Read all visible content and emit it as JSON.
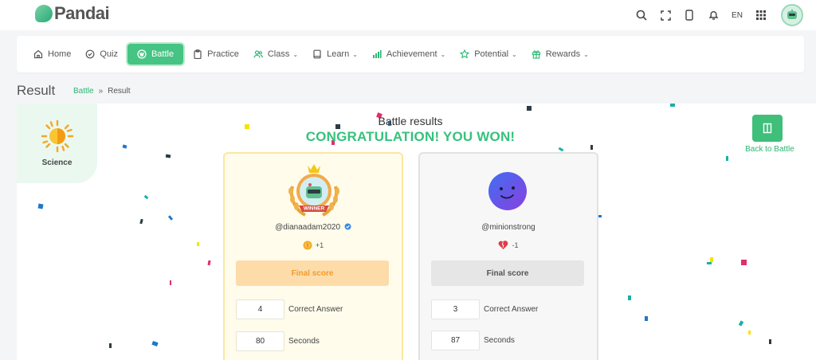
{
  "header": {
    "logo_text": "Pandai",
    "language": "EN",
    "icons": [
      "search-icon",
      "fullscreen-icon",
      "phone-icon",
      "bell-icon",
      "apps-grid-icon"
    ]
  },
  "nav": {
    "items": [
      {
        "label": "Home",
        "icon": "home-icon",
        "dropdown": false,
        "active": false
      },
      {
        "label": "Quiz",
        "icon": "check-circle-icon",
        "dropdown": false,
        "active": false
      },
      {
        "label": "Battle",
        "icon": "battle-icon",
        "dropdown": false,
        "active": true
      },
      {
        "label": "Practice",
        "icon": "clipboard-icon",
        "dropdown": false,
        "active": false
      },
      {
        "label": "Class",
        "icon": "users-icon",
        "dropdown": true,
        "active": false
      },
      {
        "label": "Learn",
        "icon": "book-icon",
        "dropdown": true,
        "active": false
      },
      {
        "label": "Achievement",
        "icon": "bar-chart-icon",
        "dropdown": true,
        "active": false
      },
      {
        "label": "Potential",
        "icon": "star-icon",
        "dropdown": true,
        "active": false
      },
      {
        "label": "Rewards",
        "icon": "gift-icon",
        "dropdown": true,
        "active": false
      }
    ]
  },
  "page": {
    "title": "Result",
    "breadcrumb": {
      "link": "Battle",
      "separator": "»",
      "current": "Result"
    }
  },
  "subject": {
    "label": "Science",
    "icon": "sun-icon"
  },
  "results": {
    "title": "Battle results",
    "message": "CONGRATULATION! YOU WON!",
    "back_label": "Back to Battle"
  },
  "players": {
    "winner": {
      "username": "@dianaadam2020",
      "verified": true,
      "badge_text": "WINNER",
      "delta": "+1",
      "delta_icon": "coin-icon",
      "score_label": "Final score",
      "correct_answers": "4",
      "correct_label": "Correct Answer",
      "seconds": "80",
      "seconds_label": "Seconds"
    },
    "loser": {
      "username": "@minionstrong",
      "delta": "-1",
      "delta_icon": "broken-heart-icon",
      "score_label": "Final score",
      "correct_answers": "3",
      "correct_label": "Correct Answer",
      "seconds": "87",
      "seconds_label": "Seconds"
    }
  },
  "colors": {
    "brand_green": "#45c483",
    "congrats_green": "#35c27c",
    "winner_card_bg": "#fffcec",
    "winner_score_bg": "#fddcaa",
    "winner_score_text": "#f29b2c"
  }
}
